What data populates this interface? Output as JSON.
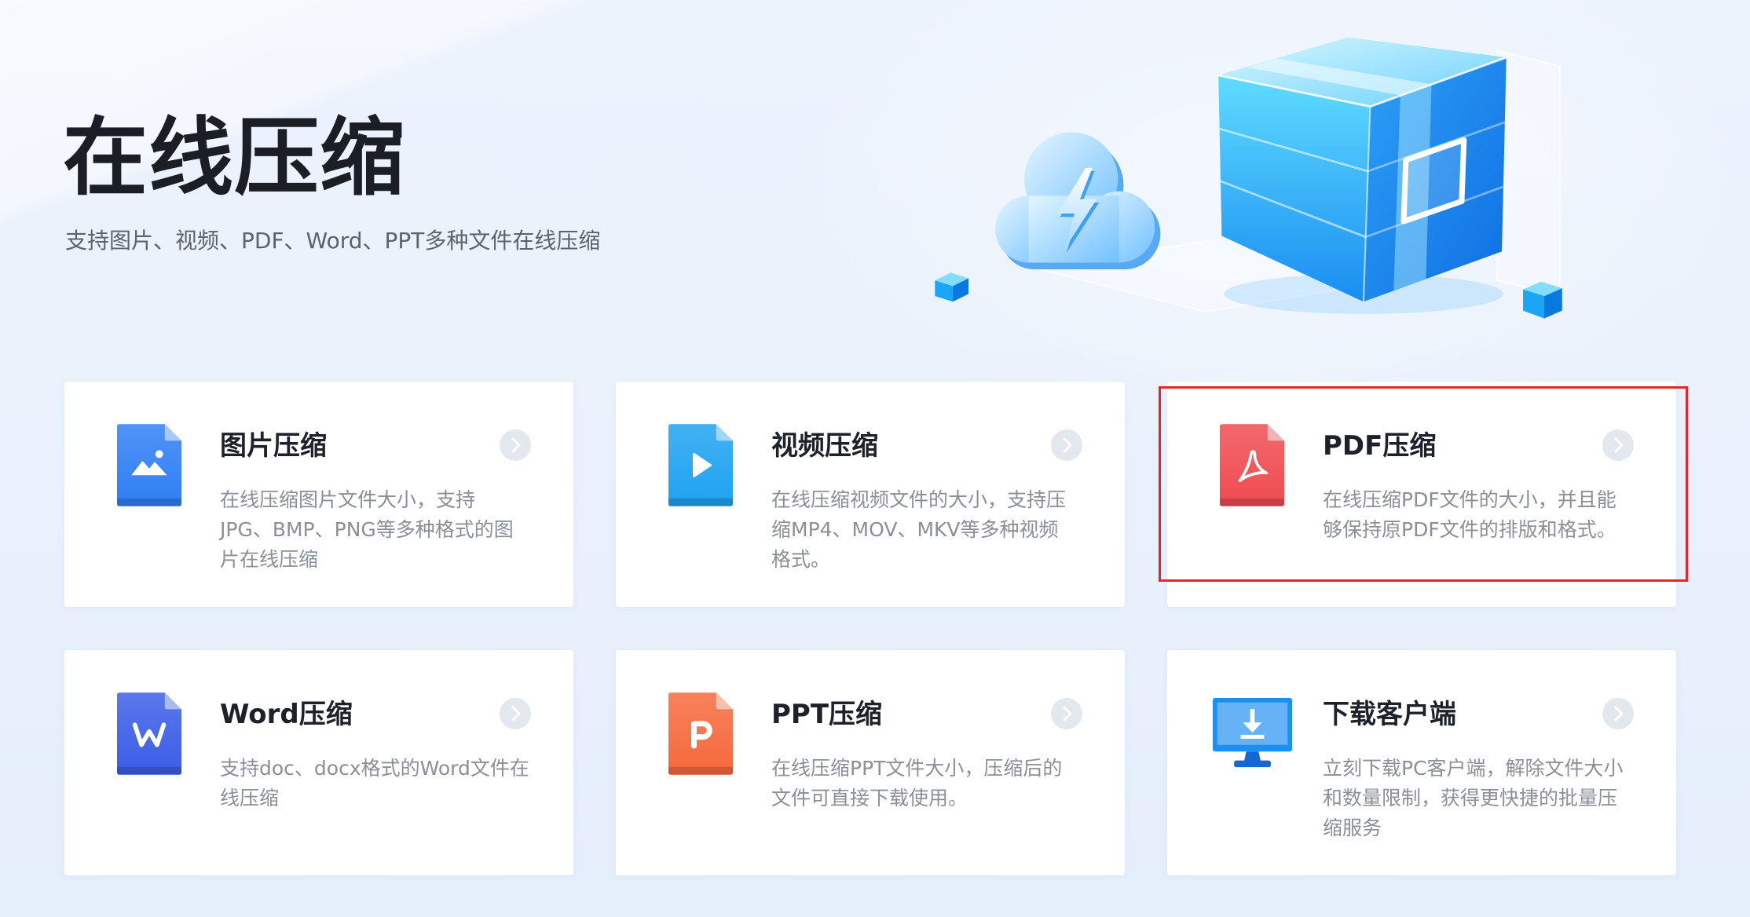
{
  "header": {
    "title": "在线压缩",
    "subtitle": "支持图片、视频、PDF、Word、PPT多种文件在线压缩"
  },
  "hero": {
    "icons": [
      "cloud-lightning-icon",
      "archive-cube-icon"
    ]
  },
  "card_arrow_icon": "chevron-right-icon",
  "cards": [
    {
      "title": "图片压缩",
      "description_lines": [
        "在线压缩图片文件大小，支持",
        "JPG、BMP、PNG等多种格式的图",
        "片在线压缩"
      ],
      "icon": "image-file-icon",
      "color": "#2f7ef5"
    },
    {
      "title": "视频压缩",
      "description_lines": [
        "在线压缩视频文件的大小，支持压",
        "缩MP4、MOV、MKV等多种视频",
        "格式。"
      ],
      "icon": "video-file-icon",
      "color": "#1ea2f1"
    },
    {
      "title": "PDF压缩",
      "description_lines": [
        "在线压缩PDF文件的大小，并且能",
        "够保持原PDF文件的排版和格式。"
      ],
      "icon": "pdf-file-icon",
      "color": "#ef4b51"
    },
    {
      "title": "Word压缩",
      "description_lines": [
        "支持doc、docx格式的Word文件在",
        "线压缩"
      ],
      "icon": "word-file-icon",
      "color": "#3b5de7"
    },
    {
      "title": "PPT压缩",
      "description_lines": [
        "在线压缩PPT文件大小，压缩后的",
        "文件可直接下载使用。"
      ],
      "icon": "ppt-file-icon",
      "color": "#f6693c"
    },
    {
      "title": "下载客户端",
      "description_lines": [
        "立刻下载PC客户端，解除文件大小",
        "和数量限制，获得更快捷的批量压",
        "缩服务"
      ],
      "icon": "desktop-download-icon",
      "color": "#1c8ff2"
    }
  ],
  "highlight": {
    "color": "#e3262b"
  }
}
